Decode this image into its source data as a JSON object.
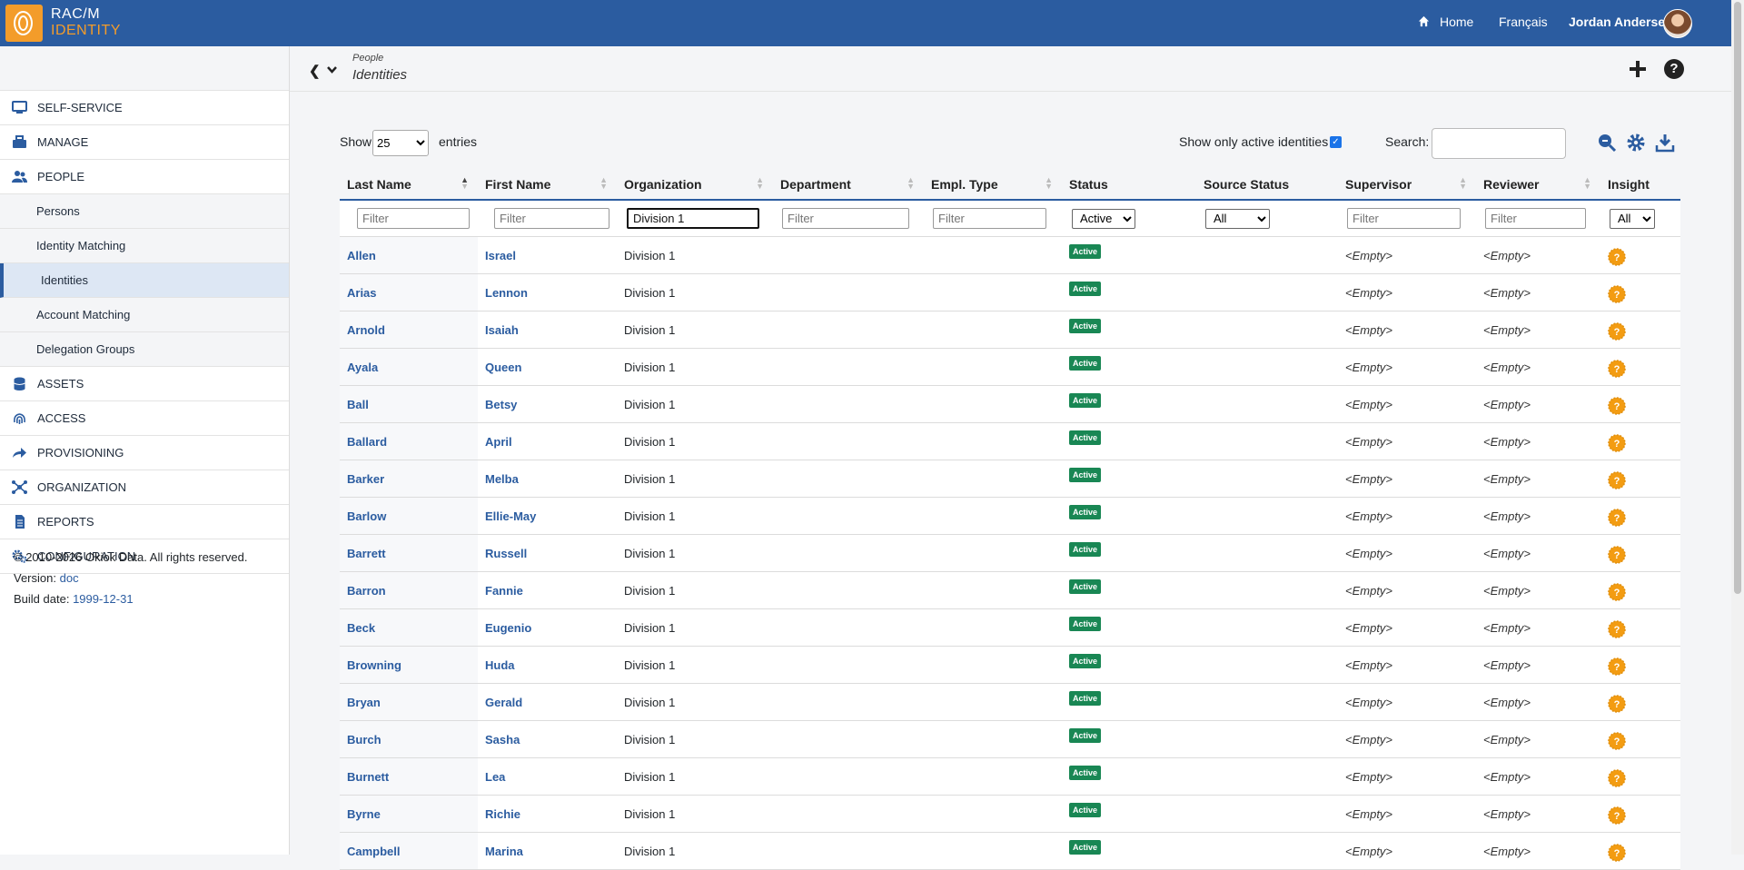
{
  "app": {
    "logo_line1": "RAC/M",
    "logo_line2": "IDENTITY"
  },
  "topnav": {
    "home": "Home",
    "language": "Français",
    "user": "Jordan Andersen"
  },
  "breadcrumb": {
    "parent": "People",
    "title": "Identities"
  },
  "sidebar": {
    "items": [
      {
        "label": "Self-Service",
        "icon": "monitor-icon"
      },
      {
        "label": "Manage",
        "icon": "toolbox-icon"
      },
      {
        "label": "People",
        "icon": "users-icon"
      }
    ],
    "people_sub": [
      "Persons",
      "Identity Matching",
      "Identities",
      "Account Matching",
      "Delegation Groups"
    ],
    "items2": [
      {
        "label": "Assets",
        "icon": "database-icon"
      },
      {
        "label": "Access",
        "icon": "fingerprint-icon"
      },
      {
        "label": "Provisioning",
        "icon": "share-arrow-icon"
      },
      {
        "label": "Organization",
        "icon": "network-icon"
      },
      {
        "label": "Reports",
        "icon": "file-icon"
      },
      {
        "label": "Configuration",
        "icon": "gears-icon"
      }
    ],
    "active_sub": "Identities"
  },
  "footer": {
    "copyright": "© 2010-2026 Okiok Data. All rights reserved.",
    "version_label": "Version:",
    "version": "doc",
    "build_label": "Build date:",
    "build_date": "1999-12-31"
  },
  "controls": {
    "show_label": "Show",
    "page_size": "25",
    "entries_label": "entries",
    "active_only_label": "Show only active identities",
    "active_only": true,
    "search_label": "Search:",
    "search_value": ""
  },
  "table": {
    "columns": [
      "Last Name",
      "First Name",
      "Organization",
      "Department",
      "Empl. Type",
      "Status",
      "Source Status",
      "Supervisor",
      "Reviewer",
      "Insight"
    ],
    "filter_placeholder": "Filter",
    "filters": {
      "organization": "Division 1",
      "status": "Active",
      "source_status": "All",
      "insight": "All"
    },
    "rows": [
      {
        "last": "Allen",
        "first": "Israel",
        "org": "Division 1",
        "status": "Active",
        "supervisor": "<Empty>",
        "reviewer": "<Empty>"
      },
      {
        "last": "Arias",
        "first": "Lennon",
        "org": "Division 1",
        "status": "Active",
        "supervisor": "<Empty>",
        "reviewer": "<Empty>"
      },
      {
        "last": "Arnold",
        "first": "Isaiah",
        "org": "Division 1",
        "status": "Active",
        "supervisor": "<Empty>",
        "reviewer": "<Empty>"
      },
      {
        "last": "Ayala",
        "first": "Queen",
        "org": "Division 1",
        "status": "Active",
        "supervisor": "<Empty>",
        "reviewer": "<Empty>"
      },
      {
        "last": "Ball",
        "first": "Betsy",
        "org": "Division 1",
        "status": "Active",
        "supervisor": "<Empty>",
        "reviewer": "<Empty>"
      },
      {
        "last": "Ballard",
        "first": "April",
        "org": "Division 1",
        "status": "Active",
        "supervisor": "<Empty>",
        "reviewer": "<Empty>"
      },
      {
        "last": "Barker",
        "first": "Melba",
        "org": "Division 1",
        "status": "Active",
        "supervisor": "<Empty>",
        "reviewer": "<Empty>"
      },
      {
        "last": "Barlow",
        "first": "Ellie-May",
        "org": "Division 1",
        "status": "Active",
        "supervisor": "<Empty>",
        "reviewer": "<Empty>"
      },
      {
        "last": "Barrett",
        "first": "Russell",
        "org": "Division 1",
        "status": "Active",
        "supervisor": "<Empty>",
        "reviewer": "<Empty>"
      },
      {
        "last": "Barron",
        "first": "Fannie",
        "org": "Division 1",
        "status": "Active",
        "supervisor": "<Empty>",
        "reviewer": "<Empty>"
      },
      {
        "last": "Beck",
        "first": "Eugenio",
        "org": "Division 1",
        "status": "Active",
        "supervisor": "<Empty>",
        "reviewer": "<Empty>"
      },
      {
        "last": "Browning",
        "first": "Huda",
        "org": "Division 1",
        "status": "Active",
        "supervisor": "<Empty>",
        "reviewer": "<Empty>"
      },
      {
        "last": "Bryan",
        "first": "Gerald",
        "org": "Division 1",
        "status": "Active",
        "supervisor": "<Empty>",
        "reviewer": "<Empty>"
      },
      {
        "last": "Burch",
        "first": "Sasha",
        "org": "Division 1",
        "status": "Active",
        "supervisor": "<Empty>",
        "reviewer": "<Empty>"
      },
      {
        "last": "Burnett",
        "first": "Lea",
        "org": "Division 1",
        "status": "Active",
        "supervisor": "<Empty>",
        "reviewer": "<Empty>"
      },
      {
        "last": "Byrne",
        "first": "Richie",
        "org": "Division 1",
        "status": "Active",
        "supervisor": "<Empty>",
        "reviewer": "<Empty>"
      },
      {
        "last": "Campbell",
        "first": "Marina",
        "org": "Division 1",
        "status": "Active",
        "supervisor": "<Empty>",
        "reviewer": "<Empty>"
      }
    ]
  },
  "colors": {
    "brand": "#2b5ca0",
    "accent": "#f39c2a",
    "status_active": "#198754"
  }
}
